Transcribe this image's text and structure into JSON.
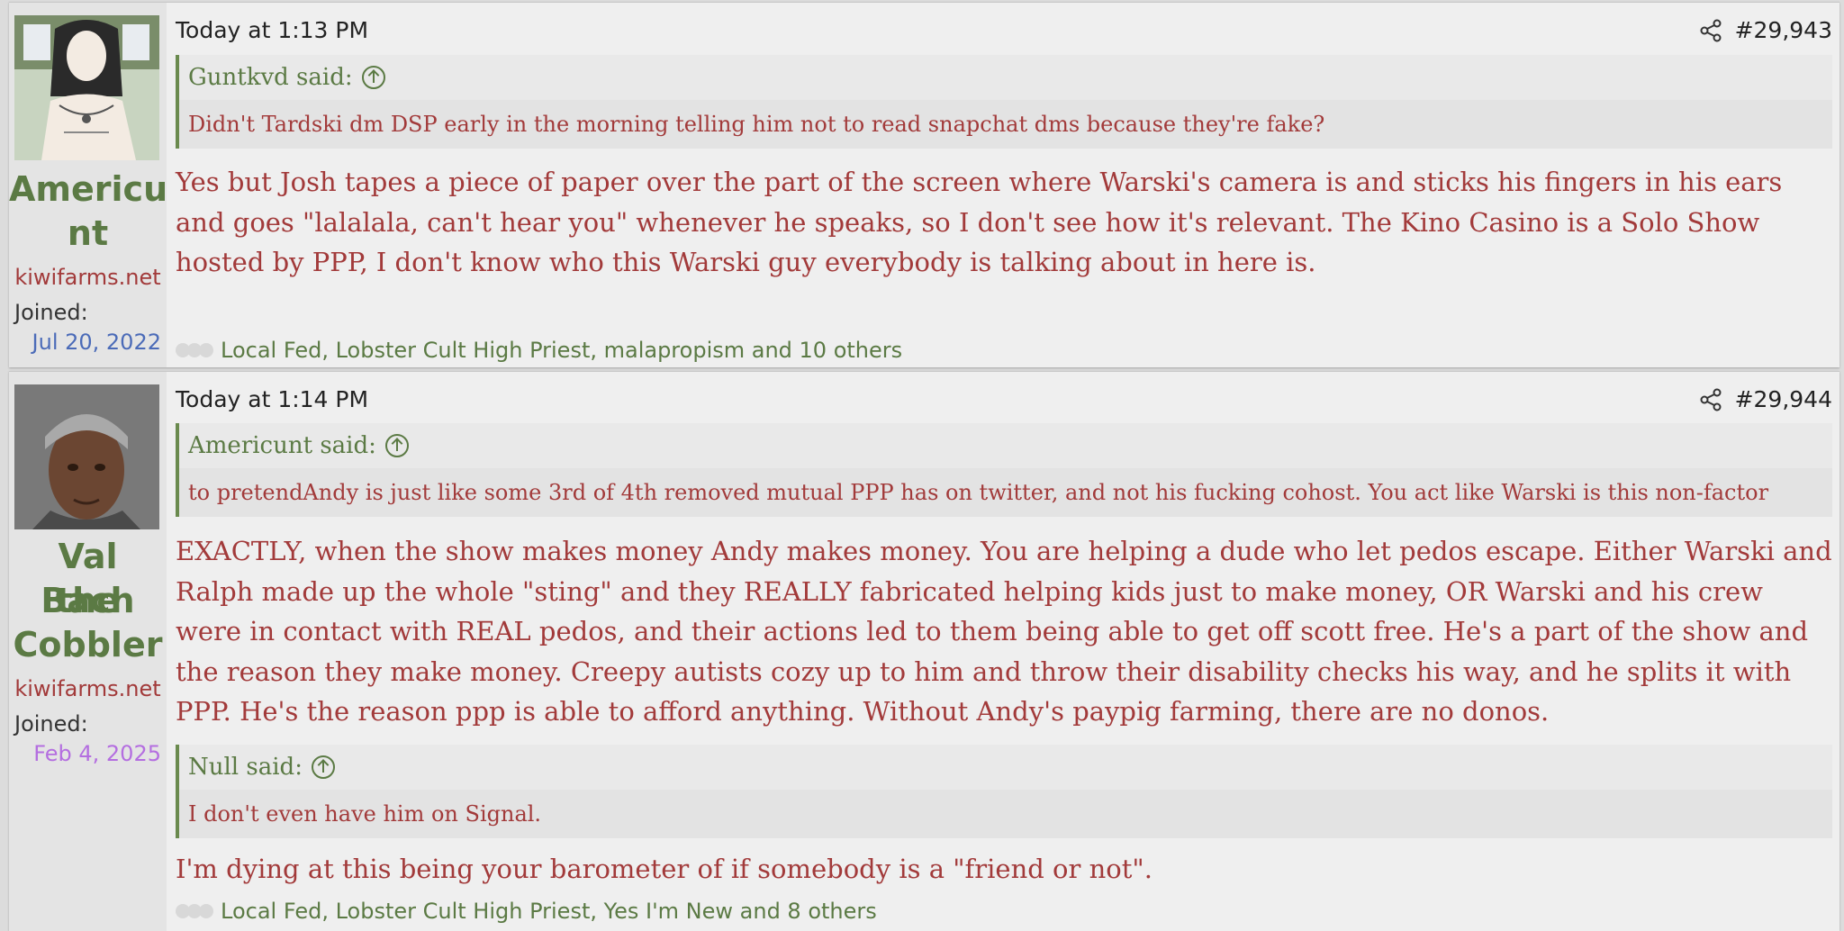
{
  "posts": [
    {
      "author": {
        "name": "Americunt",
        "name_line1": "Americu",
        "name_line2": "nt",
        "site": "kiwifarms.net",
        "joined_label": "Joined:",
        "joined_date": "Jul 20, 2022",
        "joined_color": "#4b6bb8",
        "avatar_icon": "cartoon-long-haired-man-avatar"
      },
      "timestamp": "Today at 1:13 PM",
      "post_number": "#29,943",
      "quotes": [
        {
          "author": "Guntkvd said:",
          "text": "Didn't Tardski dm DSP early in the morning telling him not to read snapchat dms because they're fake?"
        }
      ],
      "body": [
        "Yes but Josh tapes a piece of paper over the part of the screen where Warski's camera is and sticks his fingers in his ears and goes \"lalalala, can't hear you\" whenever he speaks, so I don't see how it's relevant. The Kino Casino is a Solo Show hosted by PPP, I don't know who this Warski guy everybody is talking about in here is."
      ],
      "reactions": "Local Fed, Lobster Cult High Priest, malapropism and 10 others"
    },
    {
      "author": {
        "name": "Val Bach the Cobbler",
        "name_line1": "Val Bach",
        "name_line2": "the",
        "name_line3": "Cobbler",
        "site": "kiwifarms.net",
        "joined_label": "Joined:",
        "joined_date": "Feb 4, 2025",
        "joined_color": "#b46ee0",
        "avatar_icon": "man-in-grey-beanie-avatar"
      },
      "timestamp": "Today at 1:14 PM",
      "post_number": "#29,944",
      "quotes": [
        {
          "author": "Americunt said:",
          "text": "to pretendAndy is just like some 3rd of 4th removed mutual PPP has on twitter, and not his fucking cohost. You act like Warski is this non-factor"
        },
        {
          "author": "Null said:",
          "text": "I don't even have him on Signal."
        }
      ],
      "body": [
        "EXACTLY, when the show makes money Andy makes money. You are helping a dude who let pedos escape. Either Warski and Ralph made up the whole \"sting\" and they REALLY fabricated helping kids just to make money, OR Warski and his crew were in contact with REAL pedos, and their actions led to them being able to get off scott free. He's a part of the show and the reason they make money. Creepy autists cozy up to him and throw their disability checks his way, and he splits it with PPP. He's the reason ppp is able to afford anything. Without Andy's paypig farming, there are no donos.",
        "I'm dying at this being your barometer of if somebody is a \"friend or not\"."
      ],
      "reactions": "Local Fed, Lobster Cult High Priest, Yes I'm New and 8 others"
    }
  ],
  "colors": {
    "username": "#5b7a44",
    "site": "#a23a3a",
    "quote_border": "#6a8a4e",
    "body_text": "#a23a3a"
  }
}
